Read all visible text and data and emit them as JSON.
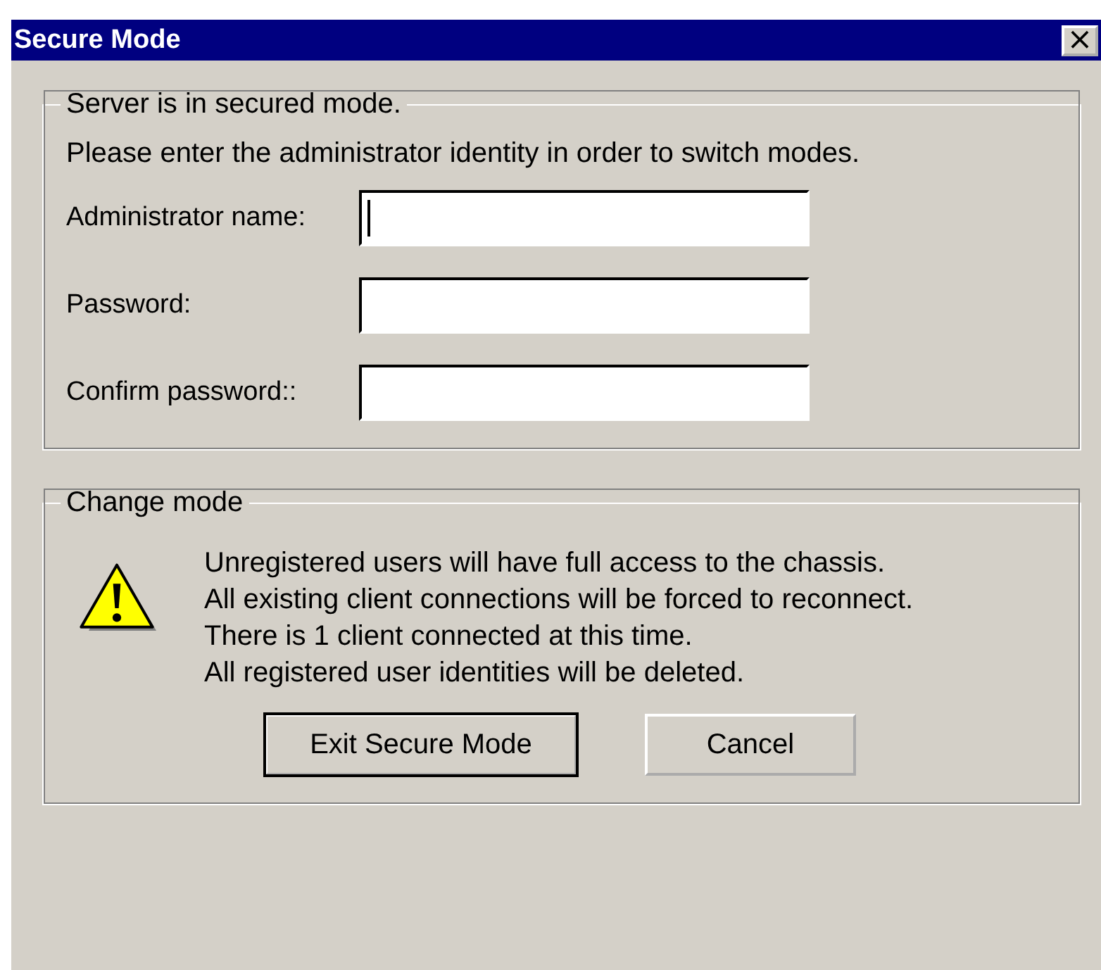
{
  "window": {
    "title": "Secure Mode",
    "close": "×"
  },
  "identity_group": {
    "legend": "Server is in secured mode.",
    "instruction": "Please enter the administrator identity in order to switch modes.",
    "fields": [
      {
        "label": "Administrator name:",
        "focused": true
      },
      {
        "label": "Password:",
        "focused": false
      },
      {
        "label": "Confirm password::",
        "focused": false
      }
    ]
  },
  "mode_group": {
    "legend": "Change mode",
    "messages": [
      "Unregistered users will have full access to the chassis.",
      "All existing client connections will be forced to reconnect. There is 1 client connected at this time.",
      "All registered user identities will be deleted."
    ],
    "buttons": [
      {
        "label": "Exit Secure Mode",
        "default": true
      },
      {
        "label": "Cancel",
        "default": false
      }
    ]
  }
}
